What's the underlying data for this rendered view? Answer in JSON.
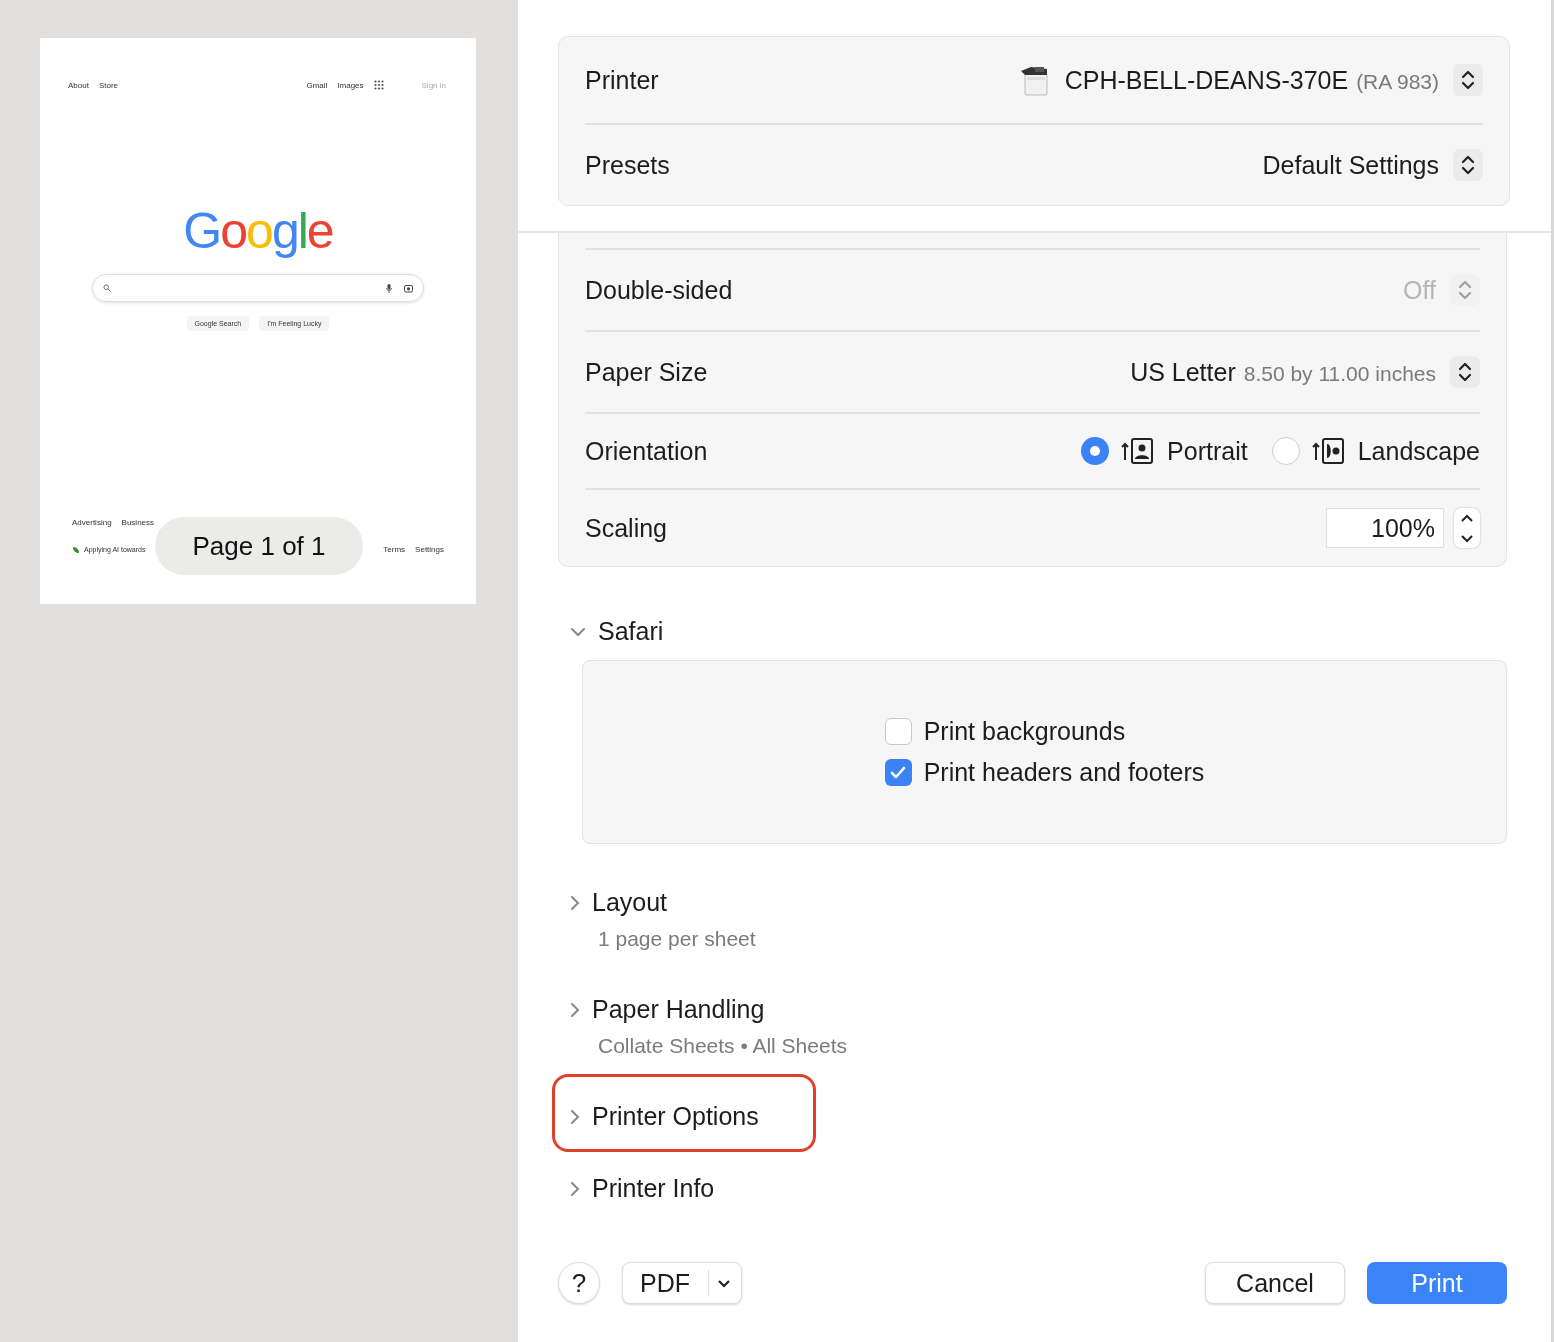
{
  "preview": {
    "nav_left": [
      "About",
      "Store"
    ],
    "nav_right": [
      "Gmail",
      "Images"
    ],
    "sign_in": "Sign in",
    "logo": "Google",
    "buttons": [
      "Google Search",
      "I'm Feeling Lucky"
    ],
    "footer_row_1": [
      "Advertising",
      "Business"
    ],
    "footer_row_2_left": "Applying AI towards",
    "footer_row_2_right": [
      "Terms",
      "Settings"
    ],
    "page_indicator": "Page 1 of 1"
  },
  "top_settings": [
    {
      "kind": "printer",
      "label": "Printer",
      "value": "CPH-BELL-DEANS-370E",
      "detail": "(RA 983)",
      "disabled": false
    },
    {
      "kind": "popup",
      "label": "Presets",
      "value": "Default Settings",
      "disabled": false
    }
  ],
  "settings": [
    {
      "kind": "popup",
      "label": "Double-sided",
      "value": "Off",
      "disabled": true
    },
    {
      "kind": "popup",
      "label": "Paper Size",
      "value": "US Letter",
      "detail": "8.50 by 11.00 inches",
      "disabled": false
    },
    {
      "kind": "radio",
      "label": "Orientation",
      "options": [
        {
          "label": "Portrait",
          "selected": true
        },
        {
          "label": "Landscape",
          "selected": false
        }
      ]
    },
    {
      "kind": "stepper",
      "label": "Scaling",
      "value": "100%"
    }
  ],
  "safari": {
    "title": "Safari",
    "expanded": true,
    "options": [
      {
        "label": "Print backgrounds",
        "checked": false
      },
      {
        "label": "Print headers and footers",
        "checked": true
      }
    ]
  },
  "sections": [
    {
      "title": "Layout",
      "summary": "1 page per sheet",
      "expanded": false,
      "highlighted": false
    },
    {
      "title": "Paper Handling",
      "summary": "Collate Sheets • All Sheets",
      "expanded": false,
      "highlighted": false
    },
    {
      "title": "Printer Options",
      "expanded": false,
      "highlighted": true
    },
    {
      "title": "Printer Info",
      "expanded": false,
      "highlighted": false
    }
  ],
  "footer": {
    "help": "?",
    "pdf": "PDF",
    "cancel": "Cancel",
    "print": "Print"
  }
}
